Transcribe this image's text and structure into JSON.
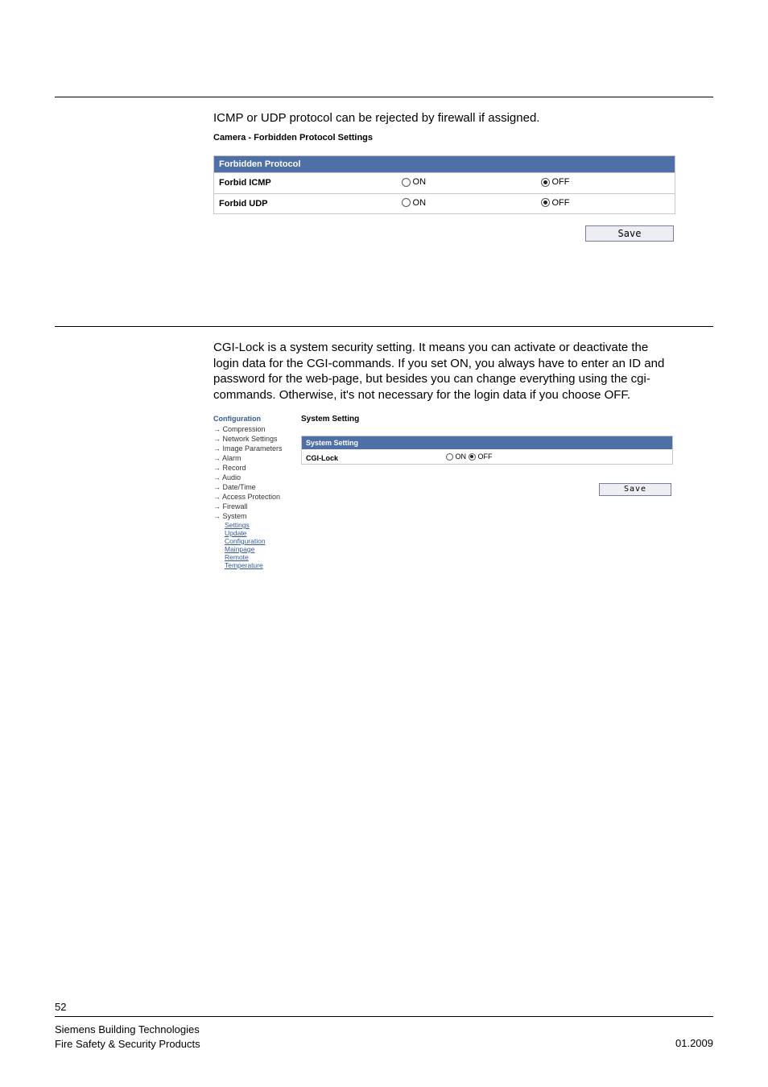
{
  "section1": {
    "intro": "ICMP or UDP protocol can be rejected by firewall if assigned.",
    "panel_title": "Camera - Forbidden Protocol Settings",
    "header": "Forbidden Protocol",
    "rows": [
      {
        "label": "Forbid ICMP",
        "on": "ON",
        "off": "OFF",
        "selected": "off"
      },
      {
        "label": "Forbid UDP",
        "on": "ON",
        "off": "OFF",
        "selected": "off"
      }
    ],
    "save": "Save"
  },
  "section2": {
    "intro": "CGI-Lock is a system security setting. It means you can activate or deactivate the login data for the CGI-commands. If you set ON, you always have to enter an ID and password for the web-page, but besides you can change everything using the cgi-commands. Otherwise, it's not necessary for the login data if you choose OFF.",
    "sidebar": {
      "title": "Configuration",
      "items": [
        "Compression",
        "Network Settings",
        "Image Parameters",
        "Alarm",
        "Record",
        "Audio",
        "Date/Time",
        "Access Protection",
        "Firewall",
        "System"
      ],
      "sublinks": [
        "Settings",
        "Update",
        "Configuration",
        "Mainpage",
        "Remote",
        "Temperature"
      ]
    },
    "right_title": "System Setting",
    "ss_header": "System Setting",
    "row": {
      "label": "CGI-Lock",
      "on": "ON",
      "off": "OFF",
      "selected": "off"
    },
    "save": "Save"
  },
  "footer": {
    "page": "52",
    "line1": "Siemens Building Technologies",
    "line2": "Fire Safety & Security Products",
    "date": "01.2009"
  }
}
